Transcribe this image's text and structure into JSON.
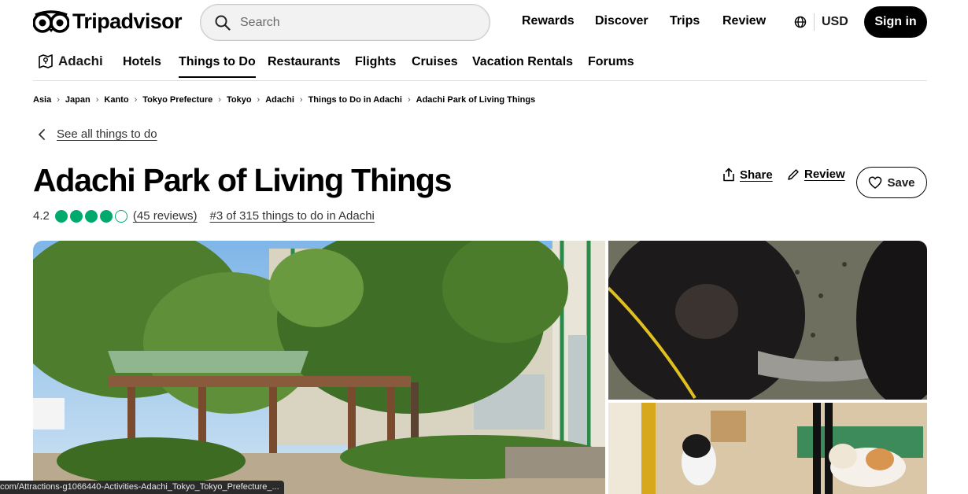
{
  "header": {
    "logo_text": "Tripadvisor",
    "search_placeholder": "Search",
    "nav": [
      "Rewards",
      "Discover",
      "Trips",
      "Review"
    ],
    "currency": "USD",
    "signin_label": "Sign in"
  },
  "subnav": {
    "location": "Adachi",
    "items": [
      "Hotels",
      "Things to Do",
      "Restaurants",
      "Flights",
      "Cruises",
      "Vacation Rentals",
      "Forums"
    ],
    "active": "Things to Do"
  },
  "breadcrumb": [
    "Asia",
    "Japan",
    "Kanto",
    "Tokyo Prefecture",
    "Tokyo",
    "Adachi",
    "Things to Do in Adachi",
    "Adachi Park of Living Things"
  ],
  "back_link": "See all things to do",
  "attraction": {
    "title": "Adachi Park of Living Things",
    "rating": "4.2",
    "rating_bubbles_filled": 4,
    "rating_bubbles_total": 5,
    "reviews_link": "(45 reviews)",
    "rank_link": "#3 of 315 things to do in Adachi"
  },
  "actions": {
    "share_label": "Share",
    "review_label": "Review",
    "save_label": "Save"
  },
  "status_url": "com/Attractions-g1066440-Activities-Adachi_Tokyo_Tokyo_Prefecture_...",
  "colors": {
    "brand_green": "#00aa6c",
    "black": "#000000"
  }
}
